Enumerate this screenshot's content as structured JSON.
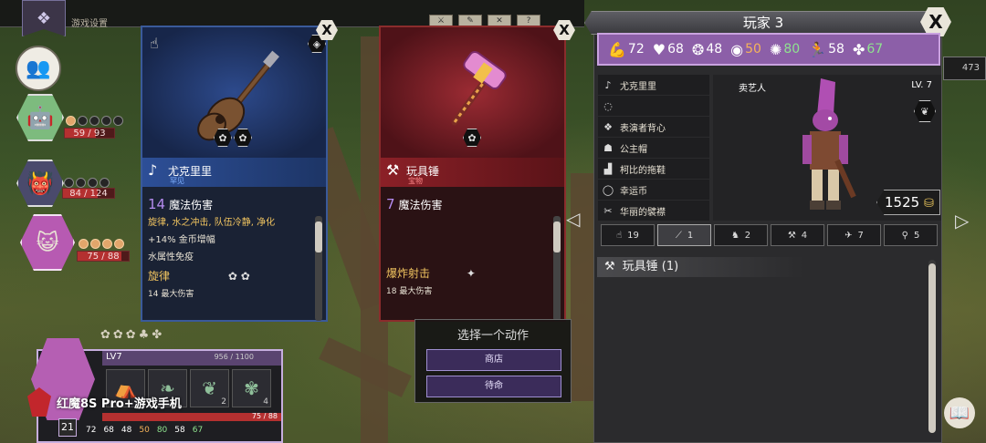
{
  "top_bar": {
    "title": "游戏设置"
  },
  "party": [
    {
      "hp_text": "59 / 93",
      "hp": 0.63,
      "pips_on": 1,
      "pips_total": 5
    },
    {
      "hp_text": "84 / 124",
      "hp": 0.68,
      "pips_on": 0,
      "pips_total": 4
    },
    {
      "hp_text": "75 / 88",
      "hp": 0.85,
      "pips_on": 4,
      "pips_total": 4
    }
  ],
  "card_left": {
    "name": "尤克里里",
    "rarity": "罕见",
    "damage_value": "14",
    "damage_label": "魔法伤害",
    "effects": "旋律, 水之冲击, 队伍冷静, 净化",
    "line1": "+14% 金币增幅",
    "line2": "水属性免疫",
    "ability": "旋律",
    "ability_sub": "14 最大伤害"
  },
  "card_right": {
    "name": "玩具锤",
    "rarity": "宝物",
    "damage_value": "7",
    "damage_label": "魔法伤害",
    "ability": "爆炸射击",
    "ability_sub": "18 最大伤害"
  },
  "action_panel": {
    "title": "选择一个动作",
    "buttons": [
      "商店",
      "待命"
    ]
  },
  "player": {
    "title": "玩家 3",
    "stats": [
      {
        "icon": "strength-icon",
        "value": "72",
        "color": "#ffffff"
      },
      {
        "icon": "heart-icon",
        "value": "68",
        "color": "#ffffff"
      },
      {
        "icon": "brain-icon",
        "value": "48",
        "color": "#ffffff"
      },
      {
        "icon": "eye-icon",
        "value": "50",
        "color": "#f5b35a"
      },
      {
        "icon": "spirit-icon",
        "value": "80",
        "color": "#8fe38f"
      },
      {
        "icon": "speed-icon",
        "value": "58",
        "color": "#ffffff"
      },
      {
        "icon": "luck-icon",
        "value": "67",
        "color": "#8fe38f"
      }
    ],
    "gear": [
      {
        "icon": "guitar-icon",
        "label": "尤克里里"
      },
      {
        "icon": "empty-slot-icon",
        "label": ""
      },
      {
        "icon": "vest-icon",
        "label": "表演者背心"
      },
      {
        "icon": "hat-icon",
        "label": "公主帽"
      },
      {
        "icon": "boot-icon",
        "label": "柯比的拖鞋"
      },
      {
        "icon": "coin-icon",
        "label": "幸运币"
      },
      {
        "icon": "bib-icon",
        "label": "华丽的襞襟"
      }
    ],
    "class": "卖艺人",
    "level": "LV. 7",
    "gold": "1525",
    "tabs": [
      {
        "icon": "hand-icon",
        "count": "19"
      },
      {
        "icon": "sword-icon",
        "count": "1"
      },
      {
        "icon": "beast-icon",
        "count": "2"
      },
      {
        "icon": "axe-icon",
        "count": "4"
      },
      {
        "icon": "bird-icon",
        "count": "7"
      },
      {
        "icon": "tool-icon",
        "count": "5"
      }
    ],
    "list_item": "玩具锤 (1)"
  },
  "hud": {
    "level_label": "LV7",
    "xp": "956 / 1100",
    "cards": [
      {
        "icon": "tent-icon",
        "count": ""
      },
      {
        "icon": "plant-icon",
        "count": ""
      },
      {
        "icon": "wheat-icon",
        "count": "2"
      },
      {
        "icon": "leaf-icon",
        "count": "4"
      }
    ],
    "hp_text": "75 / 88",
    "level_num": "21",
    "stats": [
      {
        "value": "72",
        "color": "#ffffff"
      },
      {
        "value": "68",
        "color": "#ffffff"
      },
      {
        "value": "48",
        "color": "#ffffff"
      },
      {
        "value": "50",
        "color": "#f5b35a"
      },
      {
        "value": "80",
        "color": "#8fe38f"
      },
      {
        "value": "58",
        "color": "#ffffff"
      },
      {
        "value": "67",
        "color": "#8fe38f"
      }
    ]
  },
  "watermark": "红魔8S Pro+游戏手机",
  "resource_chip": "473"
}
